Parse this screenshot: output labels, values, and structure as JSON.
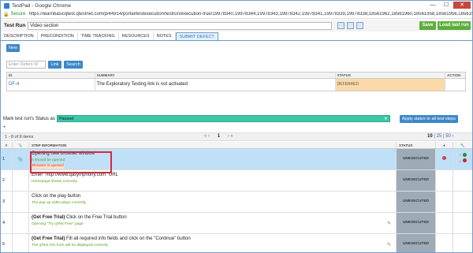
{
  "window": {
    "title": "TestPad - Google Chrome",
    "minimize": "—",
    "maximize": "☐",
    "close": "✕"
  },
  "address": {
    "secure_label": "Secure",
    "url": "https://learnbasicqtest.qtestnet.com/p/44914/portal/testexecution/testrun/execution-true/19978340,19978344,19978343,19978342,19978341,19978339,19978338,18561962,18561960,18561958,18561956,18561959"
  },
  "run": {
    "label": "Test Run",
    "name": "Video section",
    "save": "Save",
    "load_last": "Load last run"
  },
  "tabs": [
    "DESCRIPTION",
    "PRECONDITION",
    "TIME TRACKING",
    "RESOURCES",
    "NOTES",
    "SUBMIT DEFECT"
  ],
  "defect": {
    "new_button": "New",
    "input_placeholder": "Enter Defect ID",
    "link_button": "Link",
    "search_button": "Search",
    "headers": {
      "id": "ID",
      "summary": "SUMMARY",
      "status": "STATUS",
      "action": "ACTION"
    },
    "rows": [
      {
        "id": "DF-4",
        "summary": "The Exploratory Testing link is not activated",
        "status": "DEFERRED",
        "action": ""
      }
    ]
  },
  "mark_status": {
    "label": "Mark test run's Status as",
    "value": "Passed",
    "apply_button": "Apply states to all test steps"
  },
  "plus": "+",
  "pager": {
    "count": "1 - 8 of 8 items",
    "first": "«",
    "prev": "‹",
    "page": "1",
    "next": "›",
    "last": "»",
    "sizes": [
      "10",
      "25",
      "50"
    ],
    "size_sep": "|",
    "size_selected": "10",
    "size_nav": "›"
  },
  "steps": {
    "headers": {
      "num": "#",
      "info": "STEP INFORMATION",
      "status": "STATUS"
    },
    "rows": [
      {
        "num": "1",
        "step": "Opening new browser window",
        "bold": "",
        "expected": "It should be opened",
        "actual": "Browser is opened",
        "status": "UNEXECUTED",
        "selected": true
      },
      {
        "num": "2",
        "step": "Enter \"http://www.qasymphony.com\" URL",
        "bold": "",
        "expected": "Homepage shows correctly",
        "actual": "",
        "status": "UNEXECUTED",
        "selected": false
      },
      {
        "num": "3",
        "step": "Click on the play button",
        "bold": "",
        "expected": "The pop up video plays correctly",
        "actual": "",
        "status": "UNEXECUTED",
        "selected": false
      },
      {
        "num": "4",
        "step": " Click on the Free Trial button",
        "bold": "(Get Free Trial)",
        "expected": "Opening \"Try qTest Free\" page",
        "actual": "",
        "status": "UNEXECUTED",
        "selected": false
      },
      {
        "num": "5",
        "step": " Fill all required info fields and click on the \"Continue\" button",
        "bold": "(Get Free Trial)",
        "expected": "The qTest Info form will be displayed correctly",
        "actual": "",
        "status": "UNEXECUTED",
        "selected": false
      }
    ]
  },
  "colors": {
    "accent": "#3d87c9",
    "save_green": "#5cae3b",
    "status_teal": "#3ec7a6",
    "deferred": "#fbd9a9",
    "highlight": "#d52b3b"
  }
}
